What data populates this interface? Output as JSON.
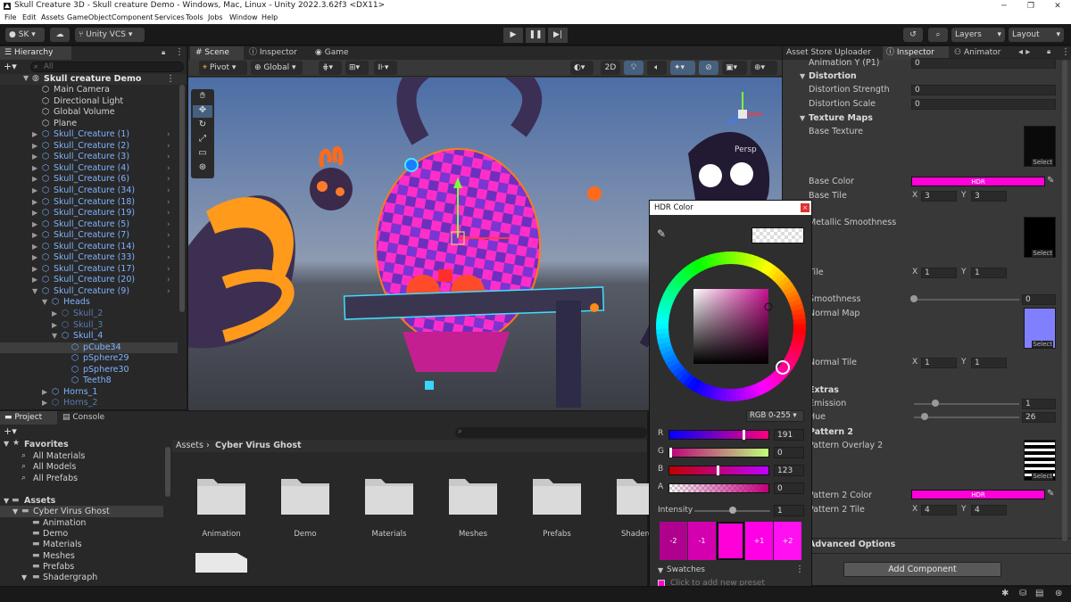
{
  "window": {
    "title": "Skull Creature 3D - Skull creature Demo - Windows, Mac, Linux - Unity 2022.3.62f3 <DX11>"
  },
  "menu": [
    "File",
    "Edit",
    "Assets",
    "GameObject",
    "Component",
    "Services",
    "Tools",
    "Jobs",
    "Window",
    "Help"
  ],
  "toolbar": {
    "account": "SK",
    "vcs": "Unity VCS",
    "layers": "Layers",
    "layout": "Layout"
  },
  "hierarchy": {
    "tab": "Hierarchy",
    "search_placeholder": "All",
    "scene": "Skull creature Demo",
    "items": [
      {
        "label": "Main Camera",
        "style": "normal",
        "indent": 1
      },
      {
        "label": "Directional Light",
        "style": "normal",
        "indent": 1
      },
      {
        "label": "Global Volume",
        "style": "normal",
        "indent": 1
      },
      {
        "label": "Plane",
        "style": "normal",
        "indent": 1
      },
      {
        "label": "Skull_Creature (1)",
        "style": "blue",
        "indent": 1,
        "fold": "right"
      },
      {
        "label": "Skull_Creature (2)",
        "style": "blue",
        "indent": 1,
        "fold": "right"
      },
      {
        "label": "Skull_Creature (3)",
        "style": "blue",
        "indent": 1,
        "fold": "right"
      },
      {
        "label": "Skull_Creature (4)",
        "style": "blue",
        "indent": 1,
        "fold": "right"
      },
      {
        "label": "Skull_Creature (6)",
        "style": "blue",
        "indent": 1,
        "fold": "right"
      },
      {
        "label": "Skull_Creature (34)",
        "style": "blue",
        "indent": 1,
        "fold": "right"
      },
      {
        "label": "Skull_Creature (18)",
        "style": "blue",
        "indent": 1,
        "fold": "right"
      },
      {
        "label": "Skull_Creature (19)",
        "style": "blue",
        "indent": 1,
        "fold": "right"
      },
      {
        "label": "Skull_Creature (5)",
        "style": "blue",
        "indent": 1,
        "fold": "right"
      },
      {
        "label": "Skull_Creature (7)",
        "style": "blue",
        "indent": 1,
        "fold": "right"
      },
      {
        "label": "Skull_Creature (14)",
        "style": "blue",
        "indent": 1,
        "fold": "right"
      },
      {
        "label": "Skull_Creature (33)",
        "style": "blue",
        "indent": 1,
        "fold": "right"
      },
      {
        "label": "Skull_Creature (17)",
        "style": "blue",
        "indent": 1,
        "fold": "right"
      },
      {
        "label": "Skull_Creature (20)",
        "style": "blue",
        "indent": 1,
        "fold": "right"
      },
      {
        "label": "Skull_Creature (9)",
        "style": "blue",
        "indent": 1,
        "fold": "down"
      },
      {
        "label": "Heads",
        "style": "blue",
        "indent": 2,
        "fold": "down"
      },
      {
        "label": "Skull_2",
        "style": "dim",
        "indent": 3,
        "fold": "right"
      },
      {
        "label": "Skull_3",
        "style": "dim",
        "indent": 3,
        "fold": "right"
      },
      {
        "label": "Skull_4",
        "style": "blue",
        "indent": 3,
        "fold": "down"
      },
      {
        "label": "pCube34",
        "style": "blue",
        "indent": 4,
        "selected": true
      },
      {
        "label": "pSphere29",
        "style": "blue",
        "indent": 4
      },
      {
        "label": "pSphere30",
        "style": "blue",
        "indent": 4
      },
      {
        "label": "Teeth8",
        "style": "blue",
        "indent": 4
      },
      {
        "label": "Horns_1",
        "style": "blue",
        "indent": 2,
        "fold": "right"
      },
      {
        "label": "Horns_2",
        "style": "dim",
        "indent": 2,
        "fold": "right"
      }
    ]
  },
  "scene": {
    "tabs": [
      "Scene",
      "Inspector",
      "Game"
    ],
    "pivot": "Pivot",
    "global": "Global",
    "mode2d": "2D",
    "persp": "Persp"
  },
  "inspector": {
    "tabs": [
      "Asset Store Uploader",
      "Inspector",
      "Animator"
    ],
    "partial_label": "Animation Y (P1)",
    "partial_value": "0",
    "distortion_header": "Distortion",
    "distortion_strength": {
      "label": "Distortion Strength",
      "value": "0"
    },
    "distortion_scale": {
      "label": "Distortion Scale",
      "value": "0"
    },
    "texture_header": "Texture Maps",
    "base_texture": "Base Texture",
    "select": "Select",
    "base_color": "Base Color",
    "hdr": "HDR",
    "base_tile": {
      "label": "Base Tile",
      "x": "3",
      "y": "3"
    },
    "metallic": "Metallic Smoothness",
    "tile": {
      "label": "Tile",
      "x": "1",
      "y": "1"
    },
    "smoothness": {
      "label": "Smoothness",
      "value": "0",
      "level": 0
    },
    "normal_map": "Normal Map",
    "normal_tile": {
      "label": "Normal Tile",
      "x": "1",
      "y": "1"
    },
    "extras_header": "Extras",
    "emission": {
      "label": "Emission",
      "value": "1",
      "level": 0.2
    },
    "hue": {
      "label": "Hue",
      "value": "26",
      "level": 0.1
    },
    "pattern_header": "Pattern 2",
    "pattern_overlay": "Pattern Overlay 2",
    "pattern_color": "Pattern 2 Color",
    "pattern_tile": {
      "label": "Pattern 2 Tile",
      "x": "4",
      "y": "4"
    },
    "advanced": "Advanced Options",
    "add_component": "Add Component",
    "x": "X",
    "y": "Y"
  },
  "project": {
    "tabs": [
      "Project",
      "Console"
    ],
    "favorites": "Favorites",
    "fav_items": [
      "All Materials",
      "All Models",
      "All Prefabs"
    ],
    "assets": "Assets",
    "tree": [
      "Cyber Virus Ghost",
      "Animation",
      "Demo",
      "Materials",
      "Meshes",
      "Prefabs",
      "Shadergraph"
    ],
    "breadcrumb": [
      "Assets",
      "Cyber Virus Ghost"
    ],
    "folders": [
      "Animation",
      "Demo",
      "Materials",
      "Meshes",
      "Prefabs",
      "Shadergra"
    ]
  },
  "hdr_picker": {
    "title": "HDR Color",
    "mode": "RGB 0-255",
    "channels": [
      {
        "label": "R",
        "value": "191"
      },
      {
        "label": "G",
        "value": "0"
      },
      {
        "label": "B",
        "value": "123"
      },
      {
        "label": "A",
        "value": "0"
      }
    ],
    "intensity": {
      "label": "Intensity",
      "value": "1",
      "level": 0.5
    },
    "stops": [
      "-2",
      "-1",
      "+1",
      "+2"
    ],
    "swatches": "Swatches",
    "add_preset": "Click to add new preset"
  },
  "colors": {
    "accent": "#ff00d8",
    "selected_blue": "#7fb3ff",
    "panel": "#383838"
  }
}
